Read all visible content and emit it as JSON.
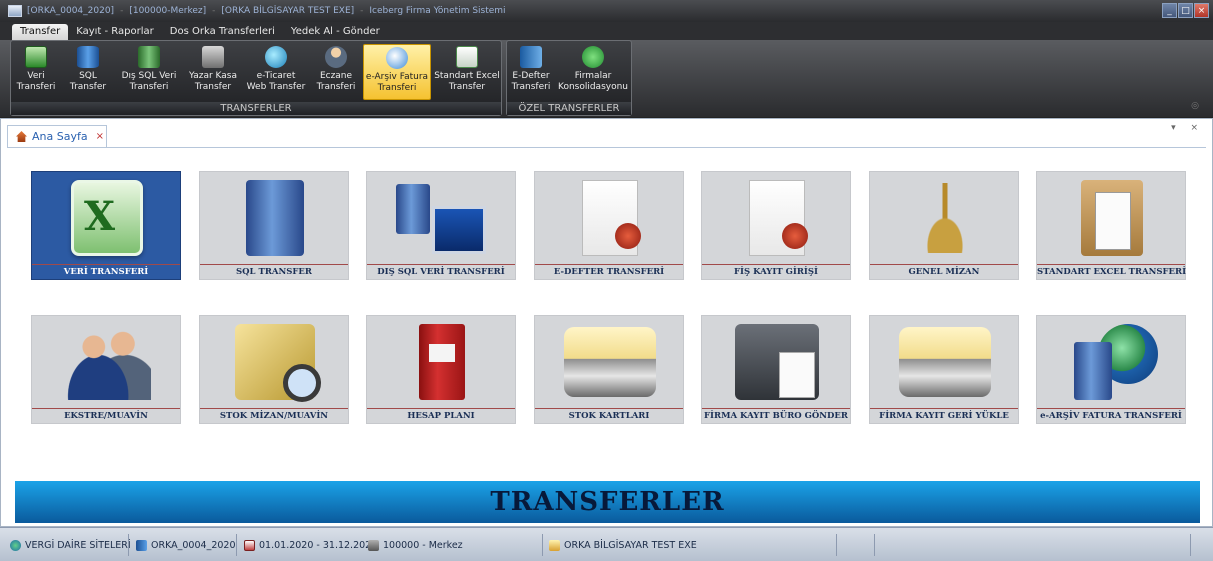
{
  "window": {
    "title_segments": [
      "[ORKA_0004_2020]",
      "[100000-Merkez]",
      "[ORKA BİLGİSAYAR TEST EXE]",
      "Iceberg Firma Yönetim Sistemi"
    ],
    "title_separator": "-",
    "controls": {
      "minimize": "_",
      "maximize": "□",
      "close": "×"
    }
  },
  "ribbon": {
    "tabs": [
      {
        "label": "Transfer",
        "active": true
      },
      {
        "label": "Kayıt - Raporlar",
        "active": false
      },
      {
        "label": "Dos Orka Transferleri",
        "active": false
      },
      {
        "label": "Yedek Al - Gönder",
        "active": false
      }
    ],
    "groups": [
      {
        "caption": "TRANSFERLER",
        "buttons": [
          {
            "line1": "Veri",
            "line2": "Transferi",
            "icon": "excel-icon"
          },
          {
            "line1": "SQL",
            "line2": "Transfer",
            "icon": "database-icon"
          },
          {
            "line1": "Dış SQL Veri",
            "line2": "Transferi",
            "icon": "external-database-icon"
          },
          {
            "line1": "Yazar Kasa",
            "line2": "Transfer",
            "icon": "cash-register-icon"
          },
          {
            "line1": "e-Ticaret",
            "line2": "Web Transfer",
            "icon": "globe-icon"
          },
          {
            "line1": "Eczane",
            "line2": "Transferi",
            "icon": "pharmacist-icon"
          },
          {
            "line1": "e-Arşiv Fatura",
            "line2": "Transferi",
            "icon": "e-archive-icon",
            "active": true
          },
          {
            "line1": "Standart Excel",
            "line2": "Transfer",
            "icon": "excel-export-icon"
          }
        ]
      },
      {
        "caption": "ÖZEL TRANSFERLER",
        "buttons": [
          {
            "line1": "E-Defter",
            "line2": "Transferi",
            "icon": "ledger-book-icon"
          },
          {
            "line1": "Firmalar",
            "line2": "Konsolidasyonu",
            "icon": "consolidation-icon"
          }
        ]
      }
    ]
  },
  "document_tab": {
    "label": "Ana Sayfa",
    "close": "×",
    "controls": "▾ ×"
  },
  "tiles_row1": [
    {
      "label": "VERİ TRANSFERİ",
      "icon": "excel-icon",
      "selected": true
    },
    {
      "label": "SQL TRANSFER",
      "icon": "server-icon"
    },
    {
      "label": "DIŞ SQL VERİ TRANSFERİ",
      "icon": "server-transfer-icon"
    },
    {
      "label": "E-DEFTER TRANSFERİ",
      "icon": "certificate-document-icon"
    },
    {
      "label": "FİŞ KAYIT GİRİŞİ",
      "icon": "certificate-document-icon"
    },
    {
      "label": "GENEL MİZAN",
      "icon": "scales-icon"
    },
    {
      "label": "STANDART EXCEL TRANSFERİ",
      "icon": "clipboard-icon"
    }
  ],
  "tiles_row2": [
    {
      "label": "EKSTRE/MUAVİN",
      "icon": "people-icon"
    },
    {
      "label": "STOK MİZAN/MUAVİN",
      "icon": "box-magnifier-icon"
    },
    {
      "label": "HESAP PLANI",
      "icon": "binder-icon"
    },
    {
      "label": "STOK KARTLARI",
      "icon": "card-tray-icon"
    },
    {
      "label": "FİRMA KAYIT BÜRO GÖNDER",
      "icon": "briefcase-icon"
    },
    {
      "label": "FİRMA KAYIT GERİ YÜKLE",
      "icon": "card-tray-icon"
    },
    {
      "label": "e-ARŞİV FATURA TRANSFERİ",
      "icon": "server-globe-icon"
    }
  ],
  "banner": {
    "text": "TRANSFERLER"
  },
  "statusbar": {
    "tax_office": "VERGİ DAİRE SİTELERİ",
    "database": "ORKA_0004_2020",
    "period": "01.01.2020 - 31.12.2020",
    "branch": "100000 - Merkez",
    "company": "ORKA BİLGİSAYAR TEST EXE"
  }
}
